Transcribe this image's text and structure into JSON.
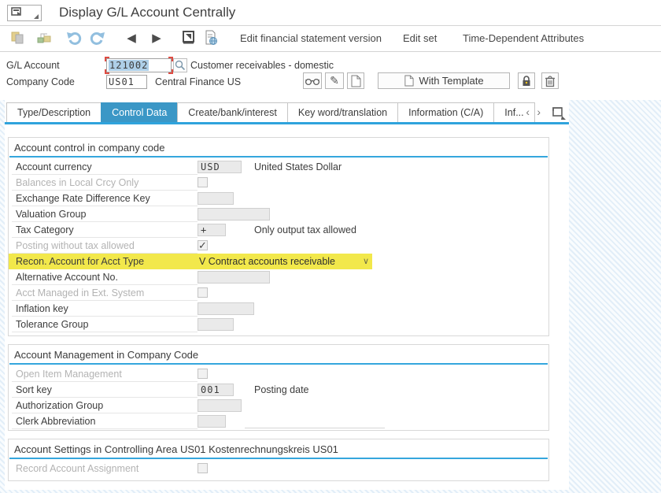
{
  "titlebar": {
    "title": "Display G/L Account Centrally",
    "icon": "session-menu-icon"
  },
  "toolbar": {
    "icons": [
      "copy-icon",
      "hierarchy-icon",
      "undo-icon",
      "redo-icon",
      "back-icon",
      "forward-icon",
      "print-icon",
      "document-globe-icon"
    ],
    "back_glyph": "◀",
    "forward_glyph": "▶",
    "text_buttons": [
      "Edit financial statement version",
      "Edit set",
      "Time-Dependent Attributes"
    ]
  },
  "header": {
    "gl_account": {
      "label": "G/L Account",
      "value": "121002",
      "description": "Customer receivables - domestic"
    },
    "company_code": {
      "label": "Company Code",
      "value": "US01",
      "description": "Central Finance US"
    },
    "action_icons": [
      "display-glasses-icon",
      "change-pencil-icon",
      "create-document-icon",
      "with-template-button",
      "lock-icon",
      "delete-trash-icon"
    ],
    "with_template_label": "With Template",
    "pencil_glyph": "✎"
  },
  "tabs": {
    "items": [
      {
        "label": "Type/Description",
        "active": false
      },
      {
        "label": "Control Data",
        "active": true
      },
      {
        "label": "Create/bank/interest",
        "active": false
      },
      {
        "label": "Key word/translation",
        "active": false
      },
      {
        "label": "Information (C/A)",
        "active": false
      },
      {
        "label": "Inf...",
        "active": false
      }
    ],
    "scroll_left_glyph": "‹",
    "scroll_right_glyph": "›"
  },
  "sections": [
    {
      "title": "Account control in company code",
      "rows": [
        {
          "label": "Account currency",
          "type": "input",
          "value": "USD",
          "description": "United States Dollar",
          "width": 56
        },
        {
          "label": "Balances in Local Crcy Only",
          "type": "checkbox",
          "checked": false,
          "disabled": true
        },
        {
          "label": "Exchange Rate Difference Key",
          "type": "input",
          "value": "",
          "width": 46
        },
        {
          "label": "Valuation Group",
          "type": "input",
          "value": "",
          "width": 92
        },
        {
          "label": "Tax Category",
          "type": "input",
          "value": "+",
          "description": "Only output tax allowed",
          "width": 36
        },
        {
          "label": "Posting without tax allowed",
          "type": "checkbox",
          "checked": true,
          "disabled": true
        },
        {
          "label": "Recon. Account for Acct Type",
          "type": "dropdown",
          "value": "V Contract accounts receivable",
          "highlight": true
        },
        {
          "label": "Alternative Account No.",
          "type": "input",
          "value": "",
          "width": 92
        },
        {
          "label": "Acct Managed in Ext. System",
          "type": "checkbox",
          "checked": false,
          "disabled": true
        },
        {
          "label": "Inflation key",
          "type": "input",
          "value": "",
          "width": 72
        },
        {
          "label": "Tolerance Group",
          "type": "input",
          "value": "",
          "width": 46
        }
      ]
    },
    {
      "title": "Account Management in Company Code",
      "rows": [
        {
          "label": "Open Item Management",
          "type": "checkbox",
          "checked": false,
          "disabled": true
        },
        {
          "label": "Sort key",
          "type": "input",
          "value": "001",
          "description": "Posting date",
          "width": 46
        },
        {
          "label": "Authorization Group",
          "type": "input",
          "value": "",
          "width": 56
        },
        {
          "label": "Clerk Abbreviation",
          "type": "input",
          "value": "",
          "width": 36,
          "tail_line": true
        }
      ]
    },
    {
      "title": "Account Settings in Controlling Area US01 Kostenrechnungskreis US01",
      "rows": [
        {
          "label": "Record Account Assignment",
          "type": "checkbox",
          "checked": false,
          "disabled": true,
          "no_line": true
        }
      ]
    }
  ],
  "colors": {
    "accent_blue": "#2fa3dc",
    "tab_active": "#3b97c6",
    "highlight_yellow": "#f2e84b",
    "selection_blue": "#aecfe8",
    "focus_red": "#de4b42"
  },
  "glyphs": {
    "checkmark": "✓",
    "dropdown_chevron": "∨"
  }
}
